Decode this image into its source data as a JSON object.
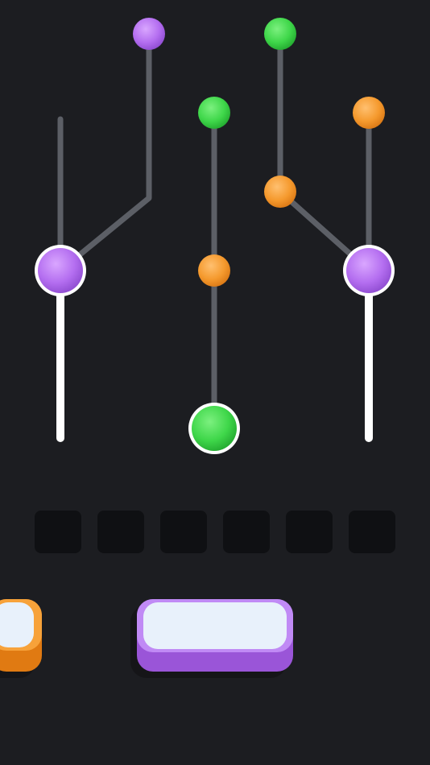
{
  "colors": {
    "background": "#1c1d21",
    "track": "#5c5f66",
    "active_track": "#ffffff",
    "slot": "#0f1013",
    "purple": "#b46ef0",
    "green": "#3fd74a",
    "orange": "#f59a2e",
    "tray_face": "#e8f1fb"
  },
  "board": {
    "paths": [
      {
        "name": "track-left-column",
        "color": "purple"
      },
      {
        "name": "track-left-branch",
        "color": "purple"
      },
      {
        "name": "track-middle-column",
        "color": "green"
      },
      {
        "name": "track-right-branch",
        "color": "green"
      },
      {
        "name": "track-right-column",
        "color": "orange"
      }
    ],
    "balls": [
      {
        "name": "ball-purple-top-left",
        "color": "purple",
        "selected": false
      },
      {
        "name": "ball-green-top-right",
        "color": "green",
        "selected": false
      },
      {
        "name": "ball-green-middle",
        "color": "green",
        "selected": false
      },
      {
        "name": "ball-orange-top-right",
        "color": "orange",
        "selected": false
      },
      {
        "name": "ball-orange-right-branch",
        "color": "orange",
        "selected": false
      },
      {
        "name": "ball-orange-middle",
        "color": "orange",
        "selected": false
      },
      {
        "name": "ball-purple-left-head",
        "color": "purple",
        "selected": true
      },
      {
        "name": "ball-purple-right-head",
        "color": "purple",
        "selected": true
      },
      {
        "name": "ball-green-middle-head",
        "color": "green",
        "selected": true
      }
    ]
  },
  "slots": {
    "count": 6,
    "filled": 0
  },
  "trays": [
    {
      "name": "tray-orange",
      "color": "orange",
      "partially_visible": true
    },
    {
      "name": "tray-purple",
      "color": "purple",
      "partially_visible": false
    }
  ]
}
